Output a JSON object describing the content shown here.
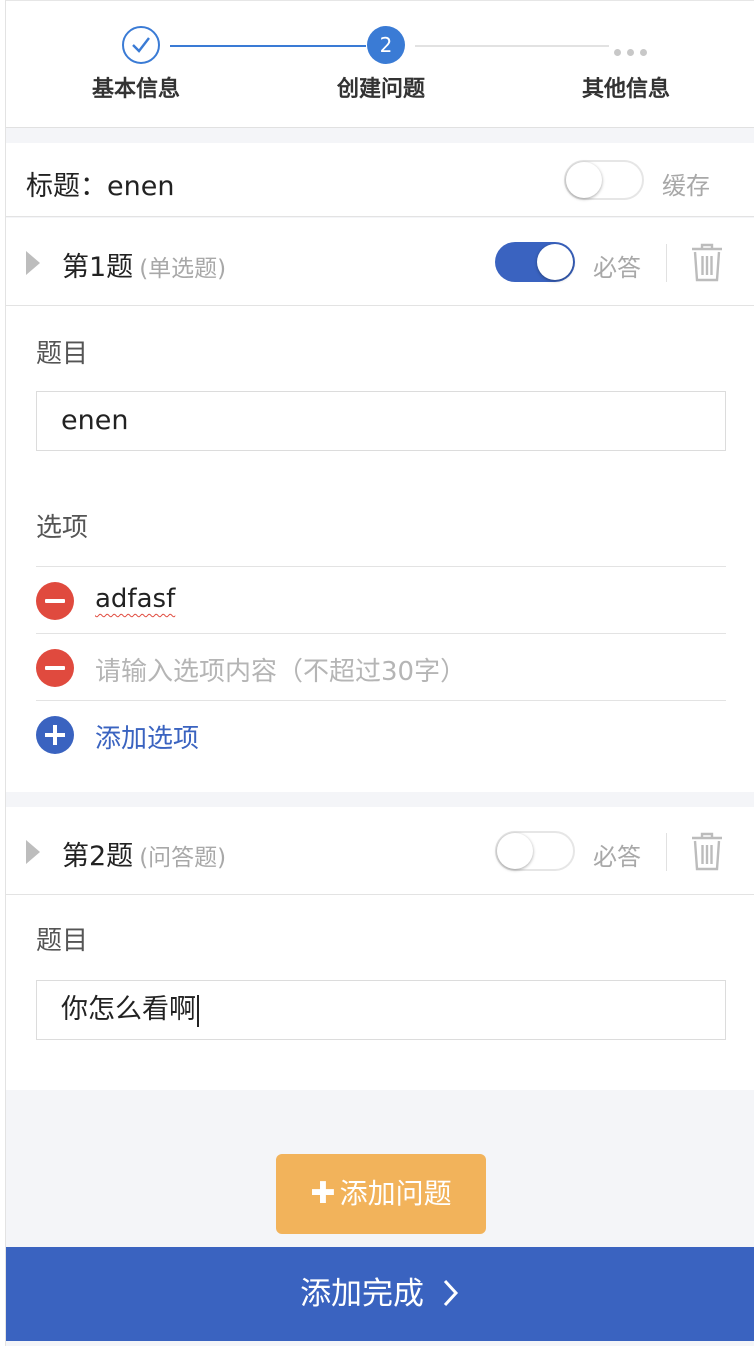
{
  "steps": [
    {
      "label": "基本信息",
      "state": "done"
    },
    {
      "label": "创建问题",
      "state": "active",
      "number": "2"
    },
    {
      "label": "其他信息",
      "state": "pending"
    }
  ],
  "title_row": {
    "label": "标题：",
    "value": "enen",
    "cache_label": "缓存",
    "cache_on": false
  },
  "questions": [
    {
      "number_label": "第1题",
      "type_label": "(单选题)",
      "required_label": "必答",
      "required_on": true,
      "subject_label": "题目",
      "subject_value": "enen",
      "options_label": "选项",
      "options": [
        {
          "value": "adfasf"
        },
        {
          "value": "",
          "placeholder": "请输入选项内容（不超过30字）"
        }
      ],
      "add_option_label": "添加选项"
    },
    {
      "number_label": "第2题",
      "type_label": "(问答题)",
      "required_label": "必答",
      "required_on": false,
      "subject_label": "题目",
      "subject_value": "你怎么看啊"
    }
  ],
  "add_question_label": "添加问题",
  "finish_label": "添加完成",
  "colors": {
    "primary": "#3a63c0",
    "step_blue": "#3a7bd5",
    "add_question": "#f2b35b",
    "remove": "#e04a3e"
  }
}
